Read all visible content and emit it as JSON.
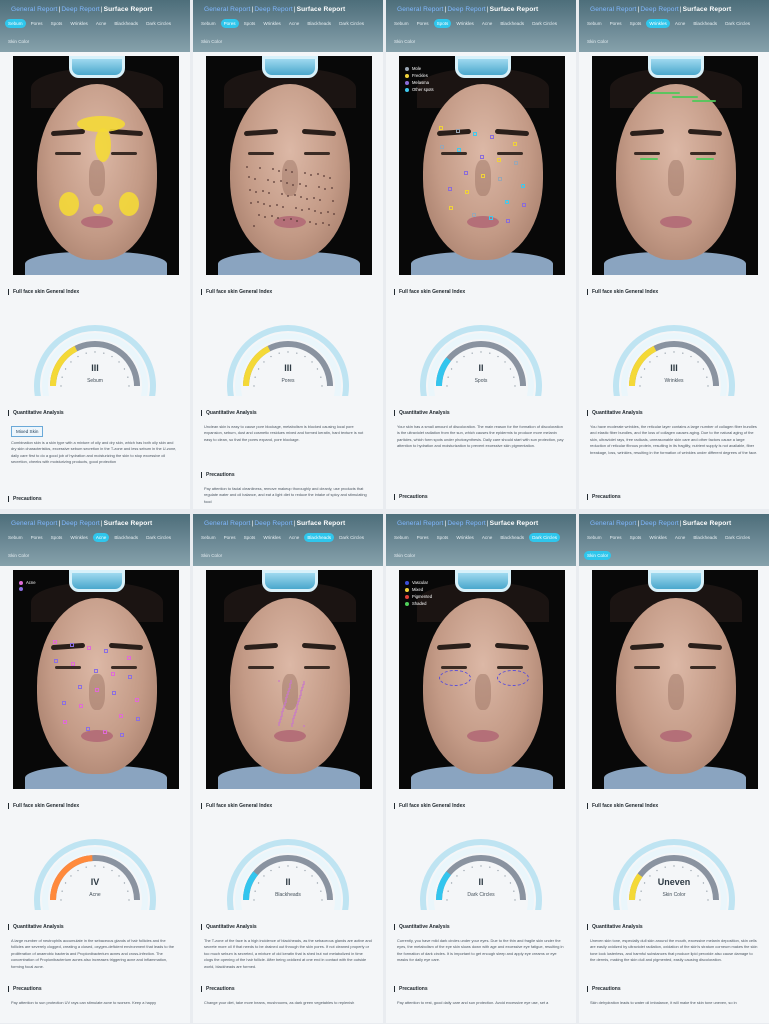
{
  "header": {
    "link_general": "General Report",
    "separator": "|",
    "link_deep": "Deep Report",
    "current": "Surface Report"
  },
  "tabs": [
    "Sebum",
    "Pores",
    "Spots",
    "Wrinkles",
    "Acne",
    "Blackheads",
    "Dark Circles",
    "Skin Color"
  ],
  "section_titles": {
    "general_index": "Full face skin General Index",
    "quantitative": "Quantitative Analysis",
    "precautions": "Precautions"
  },
  "colors": {
    "header": "#5f7e8a",
    "tab_active": "#2fc6ec",
    "gauge_track": "#8a93a0",
    "gauge_ring": "#bfe4f2",
    "yellow": "#f4d937",
    "blue": "#33c5ee",
    "orange": "#ff8a3c"
  },
  "panels": [
    {
      "active_tab": 0,
      "metric": "Sebum",
      "grade": "III",
      "level": 0.35,
      "arc_color": "#f4d937",
      "skin_type": "Mixed Skin",
      "analysis": "Combination skin is a skin type with a mixture of oily and dry skin, which has both oily skin and dry skin characteristics, excessive sebum secretion in the T-zone and less sebum in the U-zone, daily care first to do a good job of hydration and moisturizing the skin to stop excessive oil secretion, cheeks with moisturizing products, good protection",
      "precautions": "",
      "legend": []
    },
    {
      "active_tab": 1,
      "metric": "Pores",
      "grade": "III",
      "level": 0.35,
      "arc_color": "#f4d937",
      "skin_type": "",
      "analysis": "Unclean skin is easy to cause pore blockage, metabolism is blocked causing local pore expansion, sebum, dust and cosmetic residues mixed and formed keratin, hard texture is not easy to clean, so that the pores expand, pore blockage.",
      "precautions": "Pay attention to facial cleanliness, remove makeup thoroughly and cleanly, use products that regulate water and oil balance, and eat a light diet to reduce the intake of spicy and stimulating food",
      "legend": []
    },
    {
      "active_tab": 2,
      "metric": "Spots",
      "grade": "II",
      "level": 0.22,
      "arc_color": "#33c5ee",
      "skin_type": "",
      "analysis": "Your skin has a small amount of discoloration. The main reason for the formation of discoloration is the ultraviolet radiation from the sun, which causes the epidermis to produce more melanin particles, which form spots under photosynthesis. Daily care should start with sun protection, pay attention to hydration and moisturization to prevent excessive skin pigmentation.",
      "precautions": "",
      "legend": [
        {
          "label": "Mole",
          "color": "#9aa6b4"
        },
        {
          "label": "Freckles",
          "color": "#f0d23a"
        },
        {
          "label": "Melasma",
          "color": "#8a6cd8"
        },
        {
          "label": "Other spots",
          "color": "#3fc9ee"
        }
      ]
    },
    {
      "active_tab": 3,
      "metric": "Wrinkles",
      "grade": "III",
      "level": 0.35,
      "arc_color": "#f4d937",
      "skin_type": "",
      "analysis": "You have moderate wrinkles, the reticular layer contains a large number of collagen fiber bundles and elastic fiber bundles, and the loss of collagen causes aging. Due to the natural aging of the skin, ultraviolet rays, free radicals, unreasonable skin care and other factors cause a large reduction of reticular fibrous protein, resulting in its fragility, nutrient supply is not available, fiber breakage, loss, wrinkles, resulting in the formation of wrinkles under different degrees of the face.",
      "precautions": "",
      "legend": []
    },
    {
      "active_tab": 4,
      "metric": "Acne",
      "grade": "IV",
      "level": 0.48,
      "arc_color": "#ff8a3c",
      "skin_type": "",
      "analysis": "A large number of neutrophils accumulate in the sebaceous glands of hair follicles and the follicles are severely clogged, creating a closed, oxygen-deficient environment that leads to the proliferation of anaerobic bacteria and Propionibacterium acnes and cross-infection. The concentration of Propionibacterium acnes also increases triggering acne and inflammation, forming focal acne.",
      "precautions": "Pay attention to sun protection UV rays can stimulate acne to worsen. Keep a happy",
      "legend": [
        {
          "label": "Acne",
          "color": "#e06bd6"
        },
        {
          "label": "",
          "color": "#8b6fe0"
        }
      ]
    },
    {
      "active_tab": 5,
      "metric": "Blackheads",
      "grade": "II",
      "level": 0.22,
      "arc_color": "#33c5ee",
      "skin_type": "",
      "analysis": "The T-zone of the face is a high incidence of blackheads, as the sebaceous glands are active and secrete more oil if that needs to be drained out through the skin pores. If not cleaned properly or too much sebum is secreted, a mixture of old keratin that is shed but not metabolized in time clogs the opening of the hair follicle. After being oxidized at one end in contact with the outside world, blackheads are formed.",
      "precautions": "Change your diet, take more beans, mushrooms, as dark green vegetables to replenish",
      "legend": []
    },
    {
      "active_tab": 6,
      "metric": "Dark Circles",
      "grade": "II",
      "level": 0.22,
      "arc_color": "#33c5ee",
      "skin_type": "",
      "analysis": "Currently, you have mild dark circles under your eyes. Due to the thin and fragile skin under the eyes, the metabolism of the eye skin slows down with age and excessive eye fatigue, resulting in the formation of dark circles. It is important to get enough sleep and apply eye creams or eye masks for daily eye care.",
      "precautions": "Pay attention to rest, good daily care and sun protection. Avoid excessive eye use, set a",
      "legend": [
        {
          "label": "Vascular",
          "color": "#3b4fd8"
        },
        {
          "label": "Mixed",
          "color": "#f0d23a"
        },
        {
          "label": "Pigmented",
          "color": "#e0413a"
        },
        {
          "label": "Shaded",
          "color": "#4fcf5a"
        }
      ]
    },
    {
      "active_tab": 7,
      "metric": "Skin Color",
      "grade": "Uneven",
      "level": 0.2,
      "arc_color": "#f4d937",
      "skin_type": "",
      "analysis": "Uneven skin tone, especially dull skin around the mouth, excessive melanin deposition, skin cells are easily oxidized by ultraviolet radiation, oxidation of the skin's stratum corneum makes the skin tone look lusterless, and harmful substances that produce lipid peroxide also cause damage to the dermis, making the skin dull and pigmented, easily causing discoloration.",
      "precautions": "Skin dehydration leads to water oil imbalance, it will make the skin tone uneven, so in",
      "legend": []
    }
  ]
}
